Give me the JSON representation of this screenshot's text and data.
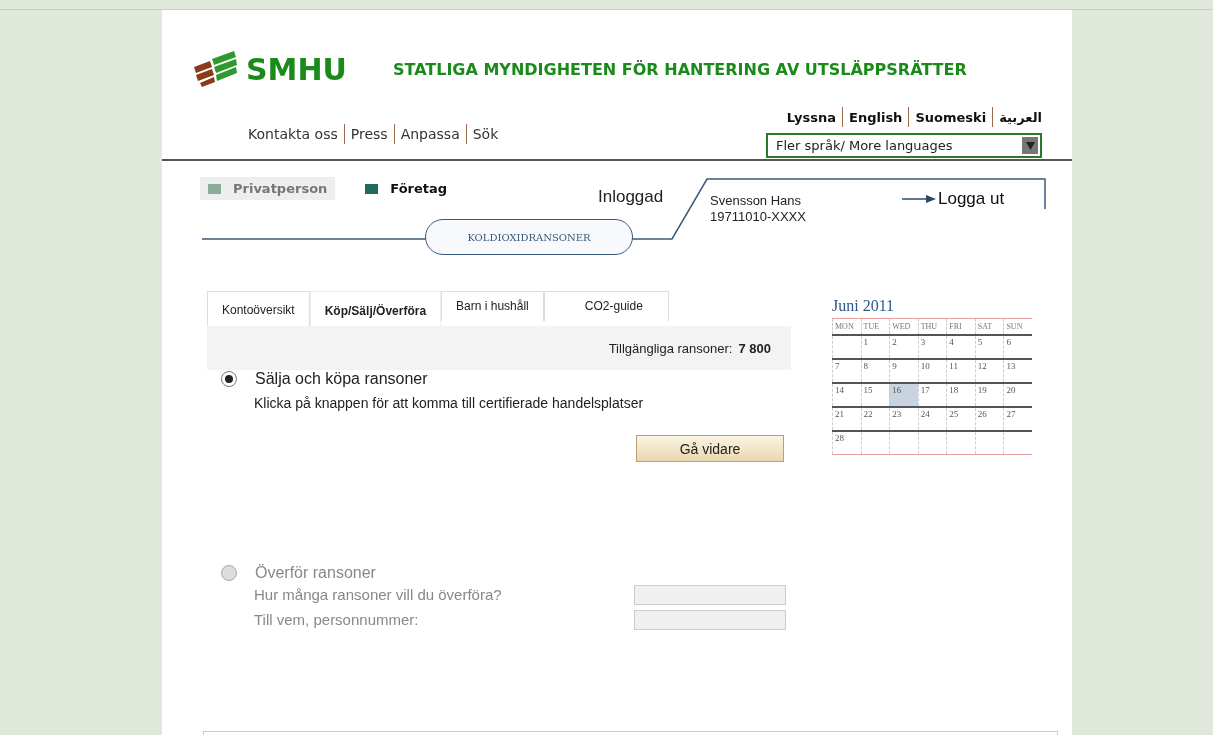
{
  "header": {
    "logo_text": "SMHU",
    "tagline": "STATLIGA MYNDIGHETEN FÖR HANTERING AV UTSLÄPPSRÄTTER"
  },
  "nav_links": [
    "Kontakta oss",
    "Press",
    "Anpassa",
    "Sök"
  ],
  "language_links": [
    "Lyssna",
    "English",
    "Suomeski",
    "العربية"
  ],
  "language_dropdown": {
    "value": "Fler språk/ More languages"
  },
  "segments": [
    {
      "label": "Privatperson",
      "selected": false
    },
    {
      "label": "Företag",
      "selected": true
    }
  ],
  "section_pill": "KOLDIOXIDRANSONER",
  "login": {
    "label": "Inloggad",
    "name": "Svensson Hans",
    "id": "19711010-XXXX",
    "logout": "Logga ut"
  },
  "tabs": [
    {
      "label": "Kontoöversikt",
      "selected": false
    },
    {
      "label": "Köp/Sälj/Överföra",
      "selected": true
    },
    {
      "label": "Barn i hushåll",
      "selected": false
    },
    {
      "label": "CO2-guide",
      "selected": false
    }
  ],
  "available": {
    "label": "Tillgängliga ransoner:",
    "value": "7 800"
  },
  "options": [
    {
      "label": "Sälja och köpa ransoner",
      "selected": true,
      "disabled": false,
      "description": "Klicka på knappen för att komma till certifierade handelsplatser",
      "button": "Gå vidare"
    },
    {
      "label": "Överför ransoner",
      "selected": false,
      "disabled": true,
      "fields": [
        {
          "label": "Hur många ransoner vill du överföra?"
        },
        {
          "label": "Till vem, personnummer:"
        }
      ]
    }
  ],
  "calendar": {
    "title": "Juni 2011",
    "weekdays": [
      "MON",
      "TUE",
      "WED",
      "THU",
      "FRI",
      "SAT",
      "SUN"
    ],
    "weeks": [
      {
        "kind": "lead",
        "days": [
          {
            "day": "1",
            "selected": false
          },
          {
            "day": "2",
            "selected": false
          },
          {
            "day": "3",
            "selected": false
          },
          {
            "day": "4",
            "selected": false
          },
          {
            "day": "5",
            "selected": false
          },
          {
            "day": "6",
            "selected": false
          }
        ]
      },
      {
        "kind": "full",
        "days": [
          {
            "day": "7",
            "selected": false
          },
          {
            "day": "8",
            "selected": false
          },
          {
            "day": "9",
            "selected": false
          },
          {
            "day": "10",
            "selected": false
          },
          {
            "day": "11",
            "selected": false
          },
          {
            "day": "12",
            "selected": false
          },
          {
            "day": "13",
            "selected": false
          }
        ]
      },
      {
        "kind": "full",
        "days": [
          {
            "day": "14",
            "selected": false
          },
          {
            "day": "15",
            "selected": false
          },
          {
            "day": "16",
            "selected": true
          },
          {
            "day": "17",
            "selected": false
          },
          {
            "day": "18",
            "selected": false
          },
          {
            "day": "19",
            "selected": false
          },
          {
            "day": "20",
            "selected": false
          }
        ]
      },
      {
        "kind": "full",
        "days": [
          {
            "day": "21",
            "selected": false
          },
          {
            "day": "22",
            "selected": false
          },
          {
            "day": "23",
            "selected": false
          },
          {
            "day": "24",
            "selected": false
          },
          {
            "day": "25",
            "selected": false
          },
          {
            "day": "26",
            "selected": false
          },
          {
            "day": "27",
            "selected": false
          }
        ]
      },
      {
        "kind": "tail",
        "days": [
          {
            "day": "28",
            "selected": false
          }
        ]
      }
    ]
  }
}
